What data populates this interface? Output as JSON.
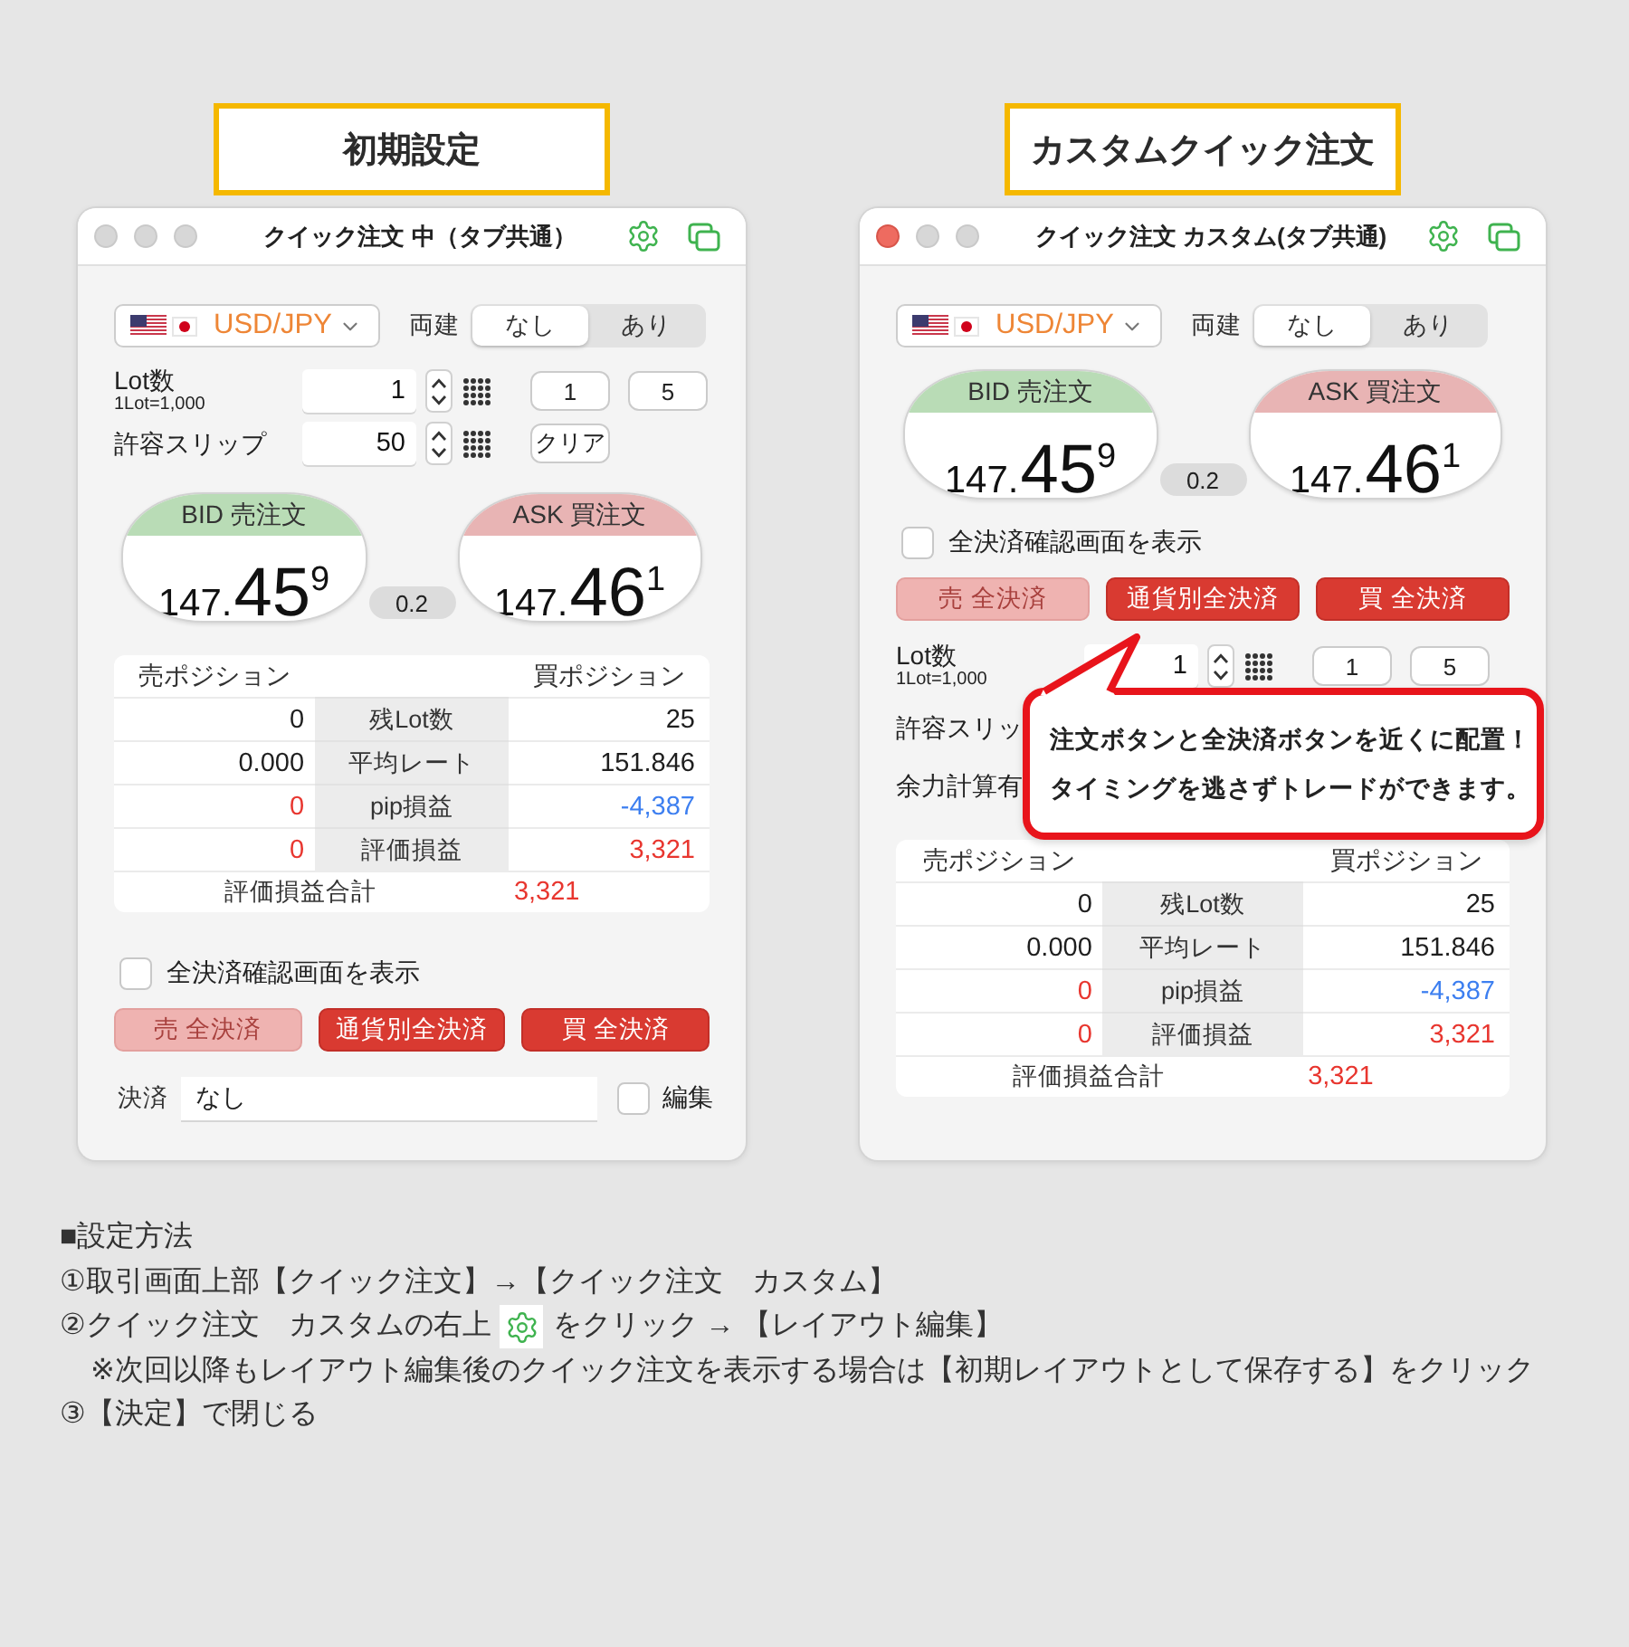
{
  "columns": [
    {
      "heading": "初期設定",
      "panel": {
        "title": "クイック注文 中（タブ共通）",
        "focused": false,
        "sections": [
          {
            "kind": "currency",
            "pair": "USD/JPY",
            "hedge_label": "両建",
            "hedge_options": [
              {
                "label": "なし",
                "selected": true
              },
              {
                "label": "あり",
                "selected": false
              }
            ]
          },
          {
            "kind": "lot",
            "label": "Lot数",
            "note": "1Lot=1,000",
            "value": "1",
            "presets": [
              "1",
              "5"
            ]
          },
          {
            "kind": "slip",
            "label": "許容スリップ",
            "value": "50",
            "action": "クリア"
          },
          {
            "kind": "prices",
            "quotes": [
              {
                "kind": "bid",
                "label": "BID 売注文",
                "prefix": "147.",
                "main": "45",
                "sup": "9"
              },
              {
                "kind": "ask",
                "label": "ASK 買注文",
                "prefix": "147.",
                "main": "46",
                "sup": "1"
              }
            ],
            "spread": "0.2"
          },
          {
            "kind": "positions",
            "headers": [
              "売ポジション",
              "買ポジション"
            ],
            "rows": [
              {
                "label": "残Lot数",
                "sell": {
                  "text": "0",
                  "color": "#1e1e1e"
                },
                "buy": {
                  "text": "25",
                  "color": "#1e1e1e"
                }
              },
              {
                "label": "平均レート",
                "sell": {
                  "text": "0.000",
                  "color": "#1e1e1e"
                },
                "buy": {
                  "text": "151.846",
                  "color": "#1e1e1e"
                }
              },
              {
                "label": "pip損益",
                "sell": {
                  "text": "0",
                  "color": "#e8362f"
                },
                "buy": {
                  "text": "-4,387",
                  "color": "#3d7ff0"
                }
              },
              {
                "label": "評価損益",
                "sell": {
                  "text": "0",
                  "color": "#e8362f"
                },
                "buy": {
                  "text": "3,321",
                  "color": "#e8362f"
                }
              }
            ],
            "total": {
              "label": "評価損益合計",
              "value": "3,321",
              "color": "#e8362f"
            }
          },
          {
            "kind": "confirm",
            "label": "全決済確認画面を表示",
            "checked": false
          },
          {
            "kind": "close_buttons",
            "buttons": [
              {
                "label": "売 全決済",
                "disabled": true
              },
              {
                "label": "通貨別全決済",
                "disabled": false
              },
              {
                "label": "買 全決済",
                "disabled": false
              }
            ]
          },
          {
            "kind": "settle",
            "label": "決済",
            "value": "なし",
            "edit_label": "編集",
            "edit_checked": false
          }
        ]
      }
    },
    {
      "heading": "カスタムクイック注文",
      "panel": {
        "title": "クイック注文 カスタム(タブ共通)",
        "focused": true,
        "sections": [
          {
            "kind": "currency",
            "pair": "USD/JPY",
            "hedge_label": "両建",
            "hedge_options": [
              {
                "label": "なし",
                "selected": true
              },
              {
                "label": "あり",
                "selected": false
              }
            ]
          },
          {
            "kind": "prices",
            "quotes": [
              {
                "kind": "bid",
                "label": "BID 売注文",
                "prefix": "147.",
                "main": "45",
                "sup": "9"
              },
              {
                "kind": "ask",
                "label": "ASK 買注文",
                "prefix": "147.",
                "main": "46",
                "sup": "1"
              }
            ],
            "spread": "0.2"
          },
          {
            "kind": "confirm",
            "label": "全決済確認画面を表示",
            "checked": false
          },
          {
            "kind": "close_buttons",
            "buttons": [
              {
                "label": "売 全決済",
                "disabled": true
              },
              {
                "label": "通貨別全決済",
                "disabled": false
              },
              {
                "label": "買 全決済",
                "disabled": false
              }
            ]
          },
          {
            "kind": "lot",
            "label": "Lot数",
            "note": "1Lot=1,000",
            "value": "1",
            "presets": [
              "1",
              "5"
            ]
          },
          {
            "kind": "label_row",
            "label": "許容スリッ"
          },
          {
            "kind": "label_row",
            "label": "余力計算有"
          },
          {
            "kind": "positions",
            "headers": [
              "売ポジション",
              "買ポジション"
            ],
            "rows": [
              {
                "label": "残Lot数",
                "sell": {
                  "text": "0",
                  "color": "#1e1e1e"
                },
                "buy": {
                  "text": "25",
                  "color": "#1e1e1e"
                }
              },
              {
                "label": "平均レート",
                "sell": {
                  "text": "0.000",
                  "color": "#1e1e1e"
                },
                "buy": {
                  "text": "151.846",
                  "color": "#1e1e1e"
                }
              },
              {
                "label": "pip損益",
                "sell": {
                  "text": "0",
                  "color": "#e8362f"
                },
                "buy": {
                  "text": "-4,387",
                  "color": "#3d7ff0"
                }
              },
              {
                "label": "評価損益",
                "sell": {
                  "text": "0",
                  "color": "#e8362f"
                },
                "buy": {
                  "text": "3,321",
                  "color": "#e8362f"
                }
              }
            ],
            "total": {
              "label": "評価損益合計",
              "value": "3,321",
              "color": "#e8362f"
            }
          }
        ],
        "callout": {
          "lines": [
            "注文ボタンと全決済ボタンを近くに配置！",
            "タイミングを逃さずトレードができます。"
          ]
        }
      }
    }
  ],
  "instructions": {
    "title": "■設定方法",
    "steps": [
      {
        "kind": "text",
        "text": "①取引画面上部【クイック注文】→【クイック注文　カスタム】"
      },
      {
        "kind": "gear",
        "before": "②クイック注文　カスタムの右上",
        "after": "をクリック → 【レイアウト編集】"
      },
      {
        "kind": "note",
        "text": "※次回以降もレイアウト編集後のクイック注文を表示する場合は【初期レイアウトとして保存する】をクリック"
      },
      {
        "kind": "text",
        "text": "③【決定】で閉じる"
      }
    ]
  }
}
